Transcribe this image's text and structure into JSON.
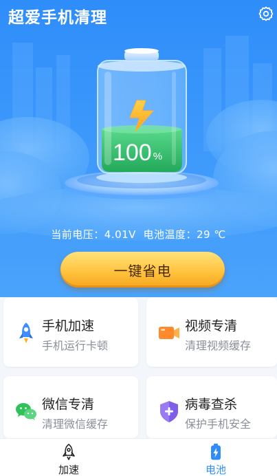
{
  "header": {
    "title": "超爱手机清理",
    "settings_icon": "gear-icon"
  },
  "battery": {
    "percent_label": "100",
    "percent_unit": "%",
    "level": 1.0
  },
  "status": {
    "voltage_label": "当前电压：",
    "voltage_value": "4.01V",
    "temp_label": "电池温度：",
    "temp_value": "29 ℃"
  },
  "action_button": {
    "label": "一键省电"
  },
  "cards": [
    {
      "title": "手机加速",
      "subtitle": "手机运行卡顿",
      "icon": "rocket-icon"
    },
    {
      "title": "视频专清",
      "subtitle": "清理视频缓存",
      "icon": "video-camera-icon"
    },
    {
      "title": "微信专清",
      "subtitle": "清理微信缓存",
      "icon": "wechat-icon"
    },
    {
      "title": "病毒查杀",
      "subtitle": "保护手机安全",
      "icon": "shield-icon"
    }
  ],
  "tabbar": {
    "tabs": [
      {
        "label": "加速",
        "icon": "rocket-outline-icon",
        "active": false
      },
      {
        "label": "电池",
        "icon": "battery-icon",
        "active": true
      }
    ]
  },
  "colors": {
    "primary": "#2f8dfa",
    "button_gold": "#ffc43f",
    "battery_green": "#35c46a",
    "tab_active": "#2f8dfa",
    "tab_inactive": "#222222"
  }
}
